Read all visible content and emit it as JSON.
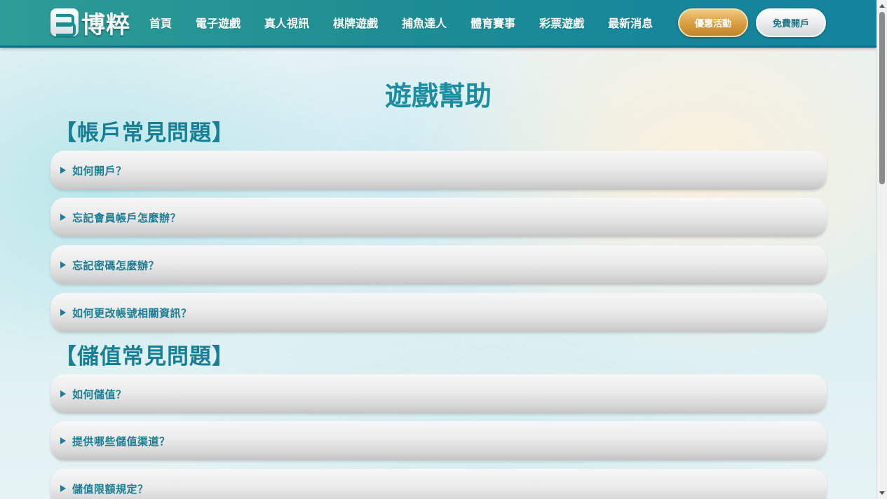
{
  "header": {
    "logo_text": "博粹",
    "nav": [
      "首頁",
      "電子遊戲",
      "真人視訊",
      "棋牌遊戲",
      "捕魚達人",
      "體育賽事",
      "彩票遊戲",
      "最新消息"
    ],
    "promo_button": "優惠活動",
    "register_button": "免費開戶"
  },
  "page": {
    "title": "遊戲幫助"
  },
  "sections": [
    {
      "title": "【帳戶常見問題】",
      "items": [
        "如何開戶？",
        "忘記會員帳戶怎麼辦？",
        "忘記密碼怎麼辦？",
        "如何更改帳號相關資訊？"
      ]
    },
    {
      "title": "【儲值常見問題】",
      "items": [
        "如何儲值？",
        "提供哪些儲值渠道？",
        "儲值限額規定？"
      ]
    }
  ],
  "colors": {
    "header_bg": "#1f8f93",
    "title": "#1a8ea0",
    "promo": "#d99d3f"
  }
}
